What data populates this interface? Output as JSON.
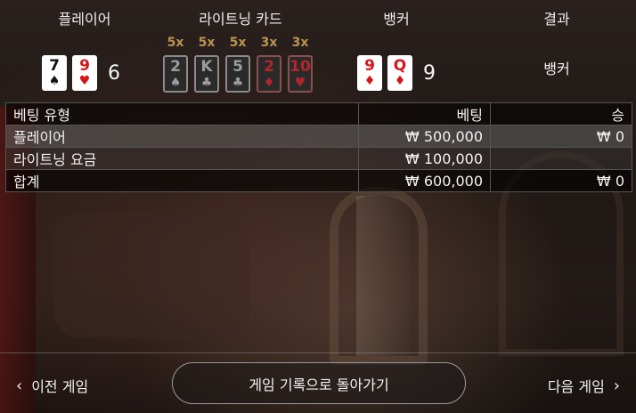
{
  "headers": {
    "player": "플레이어",
    "lightning_cards": "라이트닝 카드",
    "banker": "뱅커",
    "result": "결과"
  },
  "player": {
    "cards": [
      {
        "rank": "7",
        "suit": "♠",
        "color": "black"
      },
      {
        "rank": "9",
        "suit": "♥",
        "color": "red"
      }
    ],
    "score": "6"
  },
  "lightning": [
    {
      "mult": "5x",
      "rank": "2",
      "suit": "♠",
      "color": "black"
    },
    {
      "mult": "5x",
      "rank": "K",
      "suit": "♣",
      "color": "black"
    },
    {
      "mult": "5x",
      "rank": "5",
      "suit": "♣",
      "color": "black"
    },
    {
      "mult": "3x",
      "rank": "2",
      "suit": "♦",
      "color": "red"
    },
    {
      "mult": "3x",
      "rank": "10",
      "suit": "♥",
      "color": "red"
    }
  ],
  "banker": {
    "cards": [
      {
        "rank": "9",
        "suit": "♦",
        "color": "red"
      },
      {
        "rank": "Q",
        "suit": "♦",
        "color": "red"
      }
    ],
    "score": "9"
  },
  "result": "뱅커",
  "table": {
    "headers": [
      "베팅 유형",
      "베팅",
      "승"
    ],
    "rows": [
      [
        "플레이어",
        "₩ 500,000",
        "₩ 0"
      ],
      [
        "라이트닝 요금",
        "₩ 100,000",
        ""
      ],
      [
        "합계",
        "₩ 600,000",
        "₩ 0"
      ]
    ]
  },
  "footer": {
    "prev": "이전 게임",
    "back": "게임 기록으로 돌아가기",
    "next": "다음 게임"
  }
}
